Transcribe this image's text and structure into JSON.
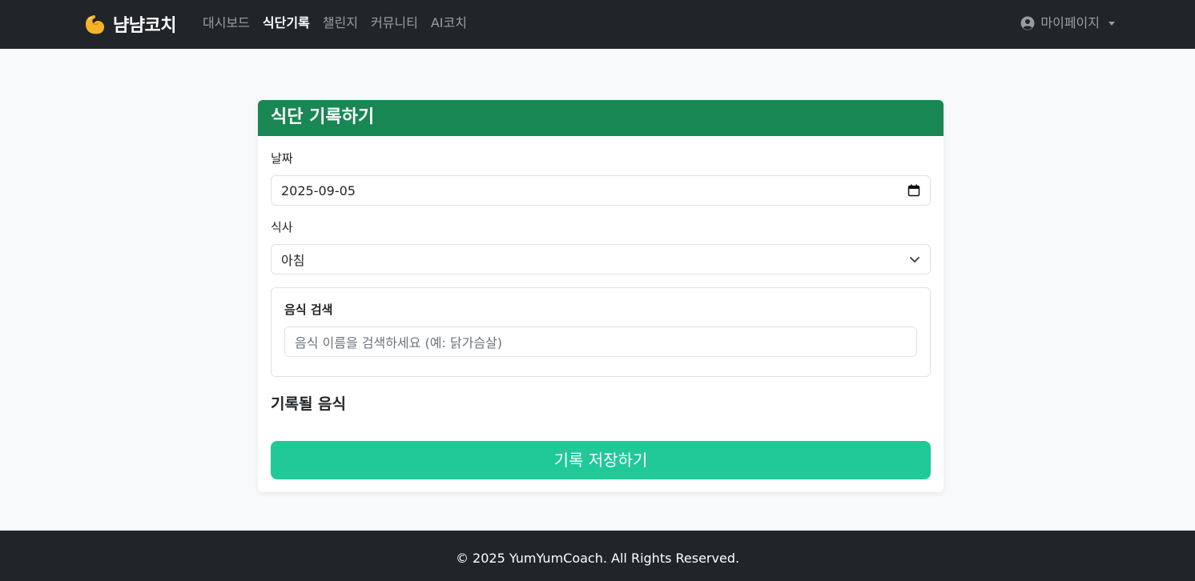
{
  "navbar": {
    "brand": {
      "icon": "flexed-biceps-icon",
      "text": "냠냠코치"
    },
    "links": [
      {
        "label": "대시보드",
        "active": false
      },
      {
        "label": "식단기록",
        "active": true
      },
      {
        "label": "챌린지",
        "active": false
      },
      {
        "label": "커뮤니티",
        "active": false
      },
      {
        "label": "AI코치",
        "active": false
      }
    ],
    "user_menu": {
      "icon": "user-circle-icon",
      "label": "마이페이지"
    }
  },
  "card": {
    "title": "식단 기록하기",
    "date": {
      "label": "날짜",
      "value": "2025-09-05",
      "icon": "calendar-icon"
    },
    "meal": {
      "label": "식사",
      "selected": "아침",
      "icon": "chevron-down-icon"
    },
    "food_search": {
      "label": "음식 검색",
      "placeholder": "음식 이름을 검색하세요 (예: 닭가슴살)"
    },
    "selected_foods_title": "기록될 음식",
    "save_button": "기록 저장하기"
  },
  "footer": {
    "text": "© 2025 YumYumCoach. All Rights Reserved."
  },
  "colors": {
    "navbar_bg": "#212529",
    "header_green": "#198754",
    "save_button_teal": "#20c997",
    "page_bg": "#f8f9fa"
  }
}
